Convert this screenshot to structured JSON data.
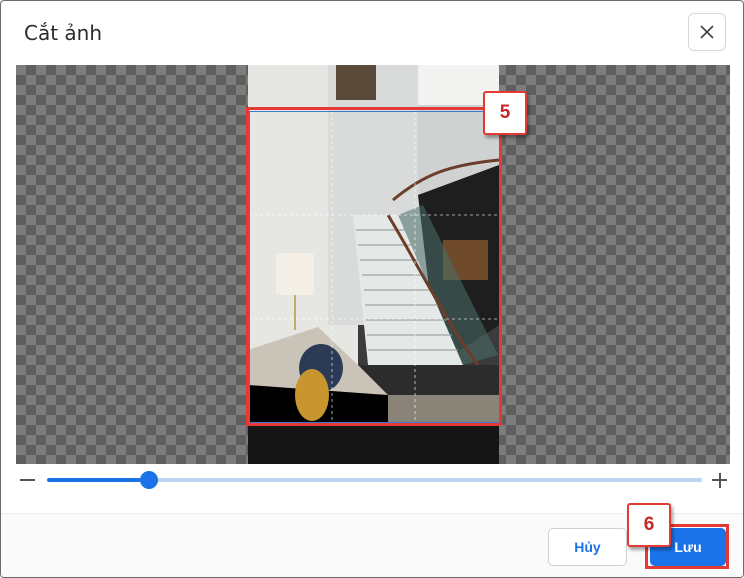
{
  "dialog": {
    "title": "Cắt ảnh",
    "close_icon": "close-icon"
  },
  "cropper": {
    "zoom_fraction": 0.155,
    "grid_visible": true
  },
  "zoom_controls": {
    "minus_icon": "minus-icon",
    "plus_icon": "plus-icon"
  },
  "footer": {
    "cancel_label": "Hủy",
    "save_label": "Lưu"
  },
  "annotations": [
    {
      "label": "5"
    },
    {
      "label": "6"
    }
  ],
  "colors": {
    "accent": "#1a73e8",
    "annotation": "#e53935"
  }
}
